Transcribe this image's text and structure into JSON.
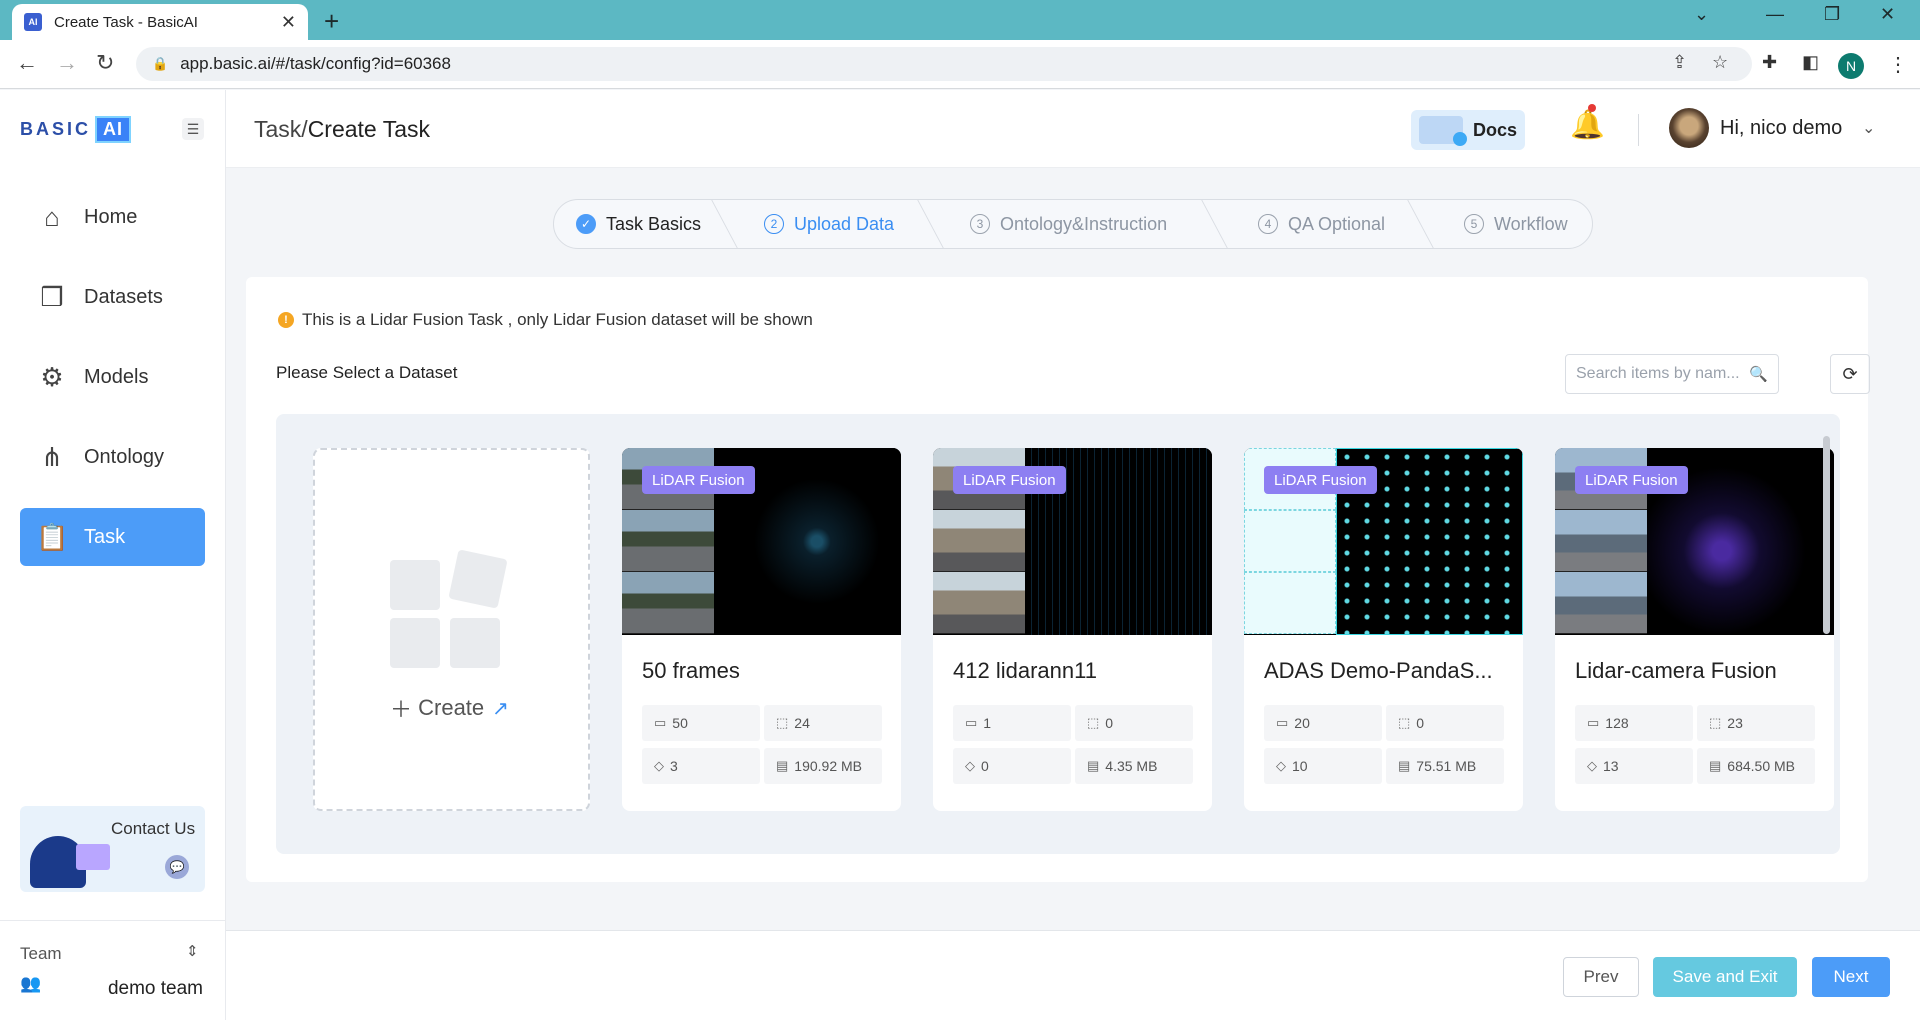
{
  "browser": {
    "tab_title": "Create Task - BasicAI",
    "favicon": "AI",
    "url": "app.basic.ai/#/task/config?id=60368",
    "profile_initial": "N"
  },
  "sidebar": {
    "logo_text": "BASIC",
    "logo_ai": "AI",
    "items": [
      {
        "label": "Home",
        "icon": "home-icon"
      },
      {
        "label": "Datasets",
        "icon": "datasets-icon"
      },
      {
        "label": "Models",
        "icon": "models-icon"
      },
      {
        "label": "Ontology",
        "icon": "ontology-icon"
      },
      {
        "label": "Task",
        "icon": "task-icon",
        "active": true
      }
    ],
    "contact_label": "Contact Us",
    "team_label": "Team",
    "team_name": "demo team"
  },
  "header": {
    "breadcrumb_parent": "Task",
    "breadcrumb_sep": "/",
    "breadcrumb_current": "Create Task",
    "docs_label": "Docs",
    "greeting": "Hi, nico demo"
  },
  "steps": [
    {
      "num": "✓",
      "label": "Task Basics",
      "state": "done"
    },
    {
      "num": "2",
      "label": "Upload Data",
      "state": "active"
    },
    {
      "num": "3",
      "label": "Ontology&Instruction",
      "state": "pending"
    },
    {
      "num": "4",
      "label": "QA Optional",
      "state": "pending"
    },
    {
      "num": "5",
      "label": "Workflow",
      "state": "pending"
    }
  ],
  "main": {
    "notice": "This is a Lidar Fusion Task , only Lidar Fusion dataset will be shown",
    "select_label": "Please Select a Dataset",
    "search_placeholder": "Search items by nam...",
    "create_label": "Create",
    "datasets": [
      {
        "tag": "LiDAR Fusion",
        "name": "50 frames",
        "items": "50",
        "annotations": "24",
        "labels": "3",
        "size": "190.92 MB"
      },
      {
        "tag": "LiDAR Fusion",
        "name": "412 lidarann11",
        "items": "1",
        "annotations": "0",
        "labels": "0",
        "size": "4.35 MB"
      },
      {
        "tag": "LiDAR Fusion",
        "name": "ADAS Demo-PandaS...",
        "items": "20",
        "annotations": "0",
        "labels": "10",
        "size": "75.51 MB"
      },
      {
        "tag": "LiDAR Fusion",
        "name": "Lidar-camera Fusion",
        "items": "128",
        "annotations": "23",
        "labels": "13",
        "size": "684.50 MB"
      }
    ]
  },
  "footer": {
    "prev": "Prev",
    "save_exit": "Save and Exit",
    "next": "Next"
  },
  "colors": {
    "primary": "#4c9cf8",
    "tag": "#8d7ff2",
    "save_button": "#65c9e0",
    "browser_frame": "#5cb8c3"
  }
}
